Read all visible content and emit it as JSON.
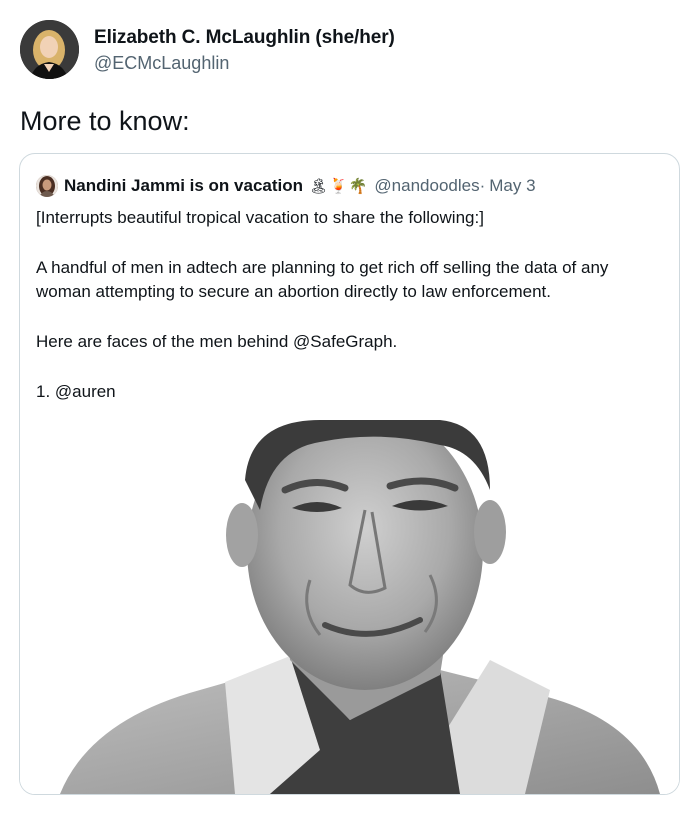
{
  "author": {
    "name": "Elizabeth C. McLaughlin (she/her)",
    "handle": "@ECMcLaughlin"
  },
  "tweet": {
    "text": "More to know:"
  },
  "quoted": {
    "name": "Nandini Jammi is on vacation",
    "emoji": "🏝🍹🌴",
    "handle": "@nandoodles",
    "separator": "·",
    "date": "May 3",
    "paragraphs": [
      "[Interrupts beautiful tropical vacation to share the following:]",
      "A handful of men in adtech are planning to get rich off selling the data of any woman attempting to secure an abortion directly to law enforcement.",
      "Here are faces of the men behind @SafeGraph.",
      "1. @auren"
    ]
  }
}
